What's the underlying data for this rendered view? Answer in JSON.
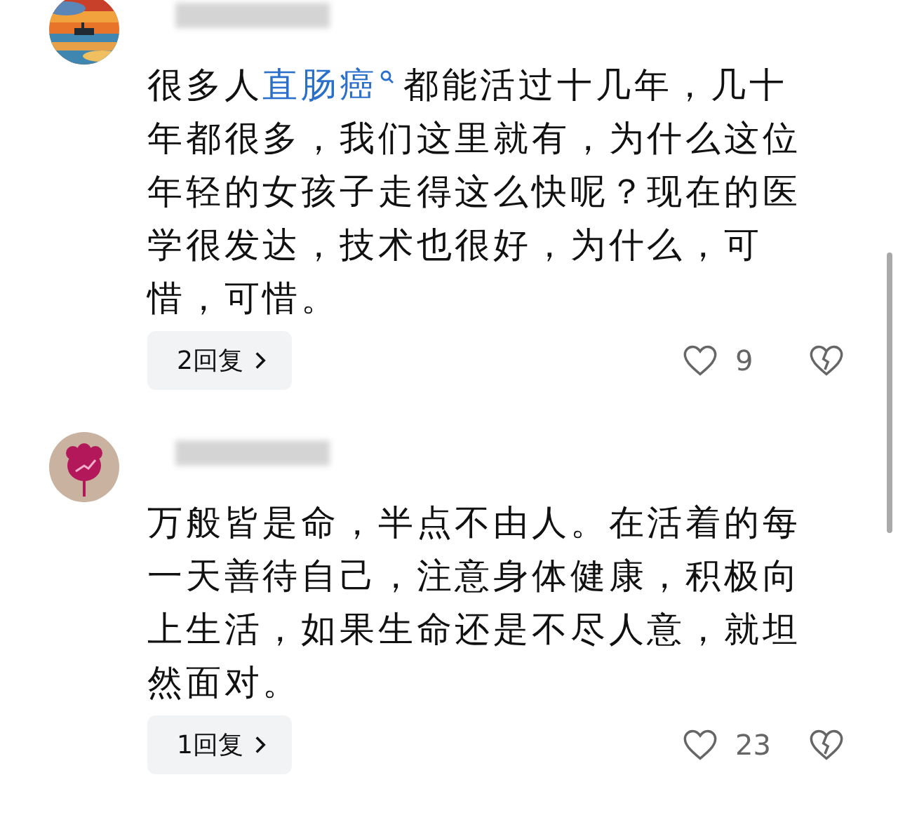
{
  "comments": [
    {
      "text_before": "很多人",
      "link": "直肠癌",
      "text_after": "都能活过十几年，几十年都很多，我们这里就有，为什么这位年轻的女孩子走得这么快呢？现在的医学很发达，技术也很好，为什么，可惜，可惜。",
      "replies": "2回复",
      "likes": "9"
    },
    {
      "text_before": "万般皆是命，半点不由人。在活着的每一天善待自己，注意身体健康，积极向上生活，如果生命还是不尽人意，就坦然面对。",
      "replies": "1回复",
      "likes": "23"
    }
  ]
}
